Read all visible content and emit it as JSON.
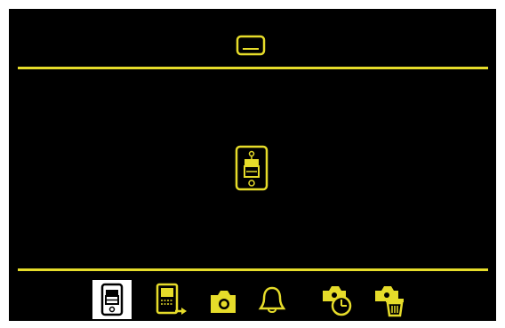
{
  "colors": {
    "background": "#000000",
    "accent": "#e6dc2a",
    "selection": "#ffffff"
  },
  "header": {
    "icon": "subtitle-icon"
  },
  "main": {
    "icon": "phone-connect-icon"
  },
  "toolbar": {
    "selected_index": 0,
    "items": [
      {
        "icon": "phone-connect-icon"
      },
      {
        "icon": "device-export-icon"
      },
      {
        "icon": "camera-icon"
      },
      {
        "icon": "bell-icon"
      },
      {
        "icon": "photo-timer-icon"
      },
      {
        "icon": "photo-delete-icon"
      }
    ]
  }
}
